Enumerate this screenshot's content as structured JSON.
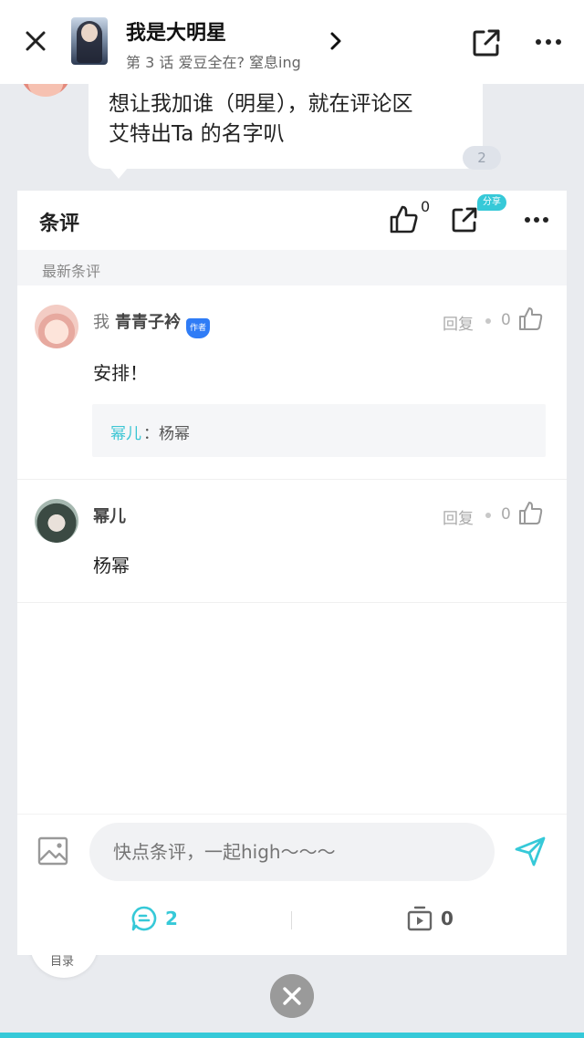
{
  "header": {
    "book_title": "我是大明星",
    "chapter_subtitle": "第 3 话 爱豆全在? 窒息ing"
  },
  "bubble": {
    "line1": "想让我加谁（明星），就在评论区",
    "line2": "艾特出Ta 的名字叭",
    "badge_count": "2"
  },
  "panel": {
    "title": "条评",
    "like_count": "0",
    "share_badge": "分享",
    "section_label": "最新条评",
    "comments": [
      {
        "me_label": "我",
        "name": "青青子衿",
        "author_badge": "作者",
        "reply_label": "回复",
        "like_count": "0",
        "body": "安排！",
        "reply": {
          "name": "幂儿",
          "text": "：杨幂"
        }
      },
      {
        "name": "幂儿",
        "reply_label": "回复",
        "like_count": "0",
        "body": "杨幂"
      }
    ],
    "input_placeholder": "快点条评，一起high～～～",
    "footer": {
      "comment_count": "2",
      "video_count": "0"
    }
  },
  "catalog_label": "目录",
  "colors": {
    "accent": "#36c9d8",
    "author_badge": "#2f7cf6",
    "background": "#e9ebef"
  }
}
